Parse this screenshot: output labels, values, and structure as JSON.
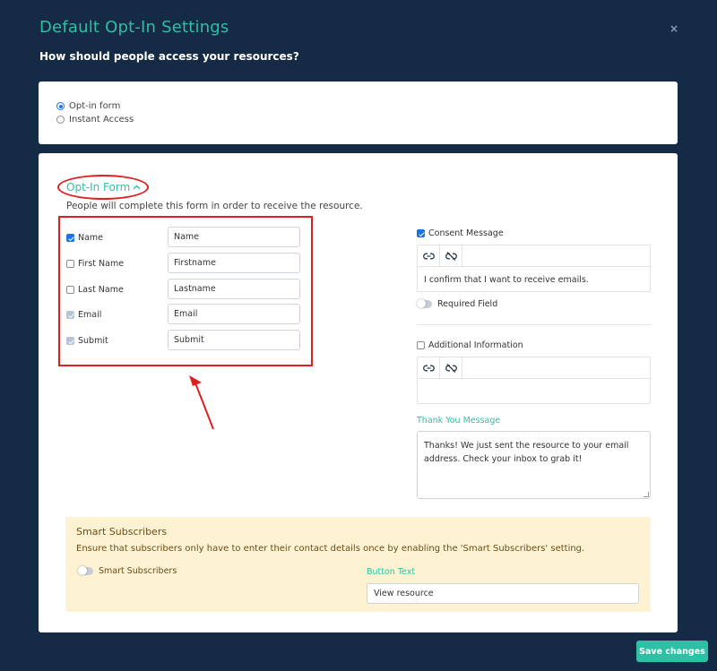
{
  "modal": {
    "title": "Default Opt-In Settings",
    "close_icon": "×",
    "subtitle": "How should people access your resources?"
  },
  "access": {
    "options": [
      {
        "label": "Opt-in form",
        "checked": true
      },
      {
        "label": "Instant Access",
        "checked": false
      }
    ]
  },
  "form": {
    "section_title": "Opt-In Form",
    "chevron_icon": "chevron-up-icon",
    "description": "People will complete this form in order to receive the resource.",
    "fields": [
      {
        "label": "Name",
        "checked": true,
        "disabled": false,
        "value": "Name"
      },
      {
        "label": "First Name",
        "checked": false,
        "disabled": false,
        "value": "Firstname"
      },
      {
        "label": "Last Name",
        "checked": false,
        "disabled": false,
        "value": "Lastname"
      },
      {
        "label": "Email",
        "checked": true,
        "disabled": true,
        "value": "Email"
      },
      {
        "label": "Submit",
        "checked": true,
        "disabled": true,
        "value": "Submit"
      }
    ]
  },
  "consent": {
    "label": "Consent Message",
    "checked": true,
    "text": "I confirm that I want to receive emails.",
    "required_label": "Required Field",
    "required_on": false
  },
  "additional": {
    "label": "Additional Information",
    "checked": false,
    "text": ""
  },
  "thank_you": {
    "label": "Thank You Message",
    "text": "Thanks! We just sent the resource to your email address. Check your inbox to grab it!"
  },
  "smart": {
    "title": "Smart Subscribers",
    "description": "Ensure that subscribers only have to enter their contact details once by enabling the 'Smart Subscribers' setting.",
    "toggle_label": "Smart Subscribers",
    "toggle_on": false,
    "button_text_label": "Button Text",
    "button_text_value": "View resource"
  },
  "footer": {
    "save_label": "Save changes"
  },
  "colors": {
    "background": "#152a45",
    "accent": "#2ebfa5",
    "annotation": "#e02020",
    "smart_bg": "#fdf3d3"
  }
}
